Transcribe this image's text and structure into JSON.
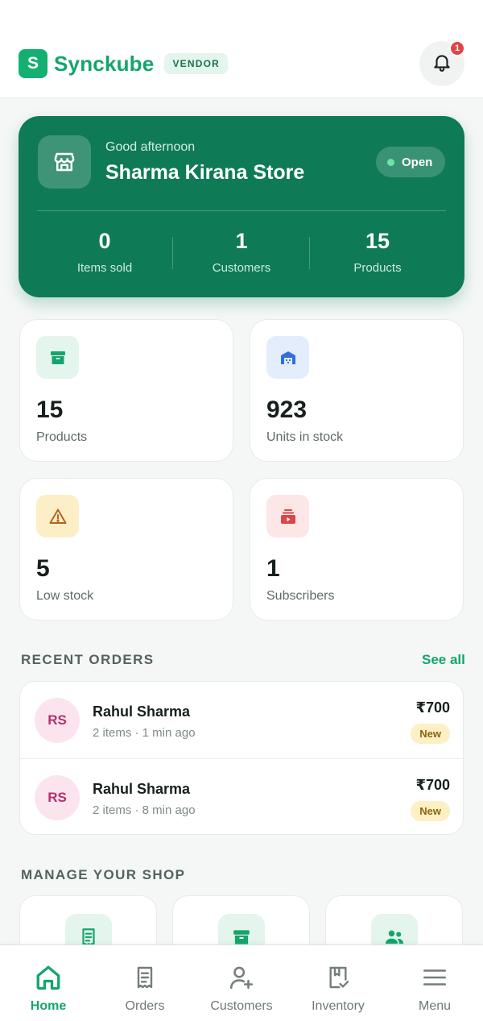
{
  "header": {
    "logo_letter": "S",
    "brand": "Synckube",
    "badge": "VENDOR",
    "notifications_count": "1",
    "bell_icon": "bell-icon"
  },
  "hero": {
    "greeting": "Good afternoon",
    "store_name": "Sharma Kirana Store",
    "status": "Open",
    "stats": [
      {
        "value": "0",
        "label": "Items sold"
      },
      {
        "value": "1",
        "label": "Customers"
      },
      {
        "value": "15",
        "label": "Products"
      }
    ]
  },
  "tiles": [
    {
      "value": "15",
      "label": "Products",
      "icon": "archive-box-icon",
      "color": "#14a56c"
    },
    {
      "value": "923",
      "label": "Units in stock",
      "icon": "warehouse-icon",
      "color": "#2f6fe0"
    },
    {
      "value": "5",
      "label": "Low stock",
      "icon": "warning-triangle-icon",
      "color": "#b5651d"
    },
    {
      "value": "1",
      "label": "Subscribers",
      "icon": "subscriptions-icon",
      "color": "#d94848"
    }
  ],
  "recent_orders": {
    "title": "RECENT ORDERS",
    "see_all": "See all",
    "items": [
      {
        "initials": "RS",
        "name": "Rahul Sharma",
        "meta": "2 items · 1 min ago",
        "amount": "₹700",
        "status": "New"
      },
      {
        "initials": "RS",
        "name": "Rahul Sharma",
        "meta": "2 items · 8 min ago",
        "amount": "₹700",
        "status": "New"
      }
    ]
  },
  "manage": {
    "title": "MANAGE YOUR SHOP",
    "icons": [
      "receipt-icon",
      "archive-box-icon",
      "people-icon"
    ]
  },
  "nav": [
    {
      "label": "Home",
      "icon": "home-icon",
      "active": true
    },
    {
      "label": "Orders",
      "icon": "receipt-icon"
    },
    {
      "label": "Customers",
      "icon": "add-user-icon"
    },
    {
      "label": "Inventory",
      "icon": "inventory-icon"
    },
    {
      "label": "Menu",
      "icon": "menu-icon"
    }
  ],
  "colors": {
    "brand": "#14a56c",
    "hero_bg": "#0f7a56",
    "badge_red": "#e24444",
    "status_new": "#fdf0c4"
  }
}
